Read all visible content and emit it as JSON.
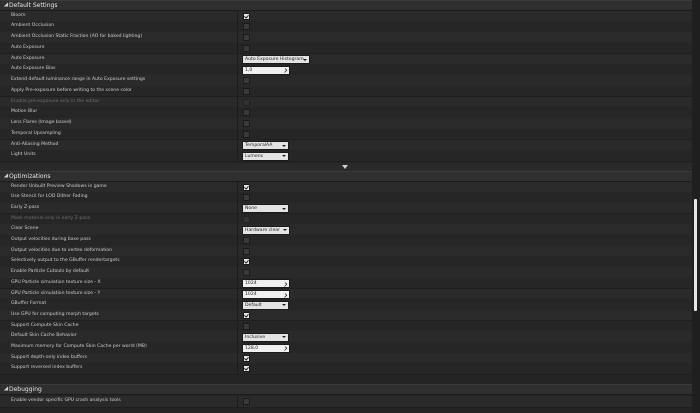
{
  "sections": {
    "default_settings": {
      "title": "Default Settings",
      "rows": [
        {
          "label": "Bloom",
          "control": "checkbox",
          "checked": true
        },
        {
          "label": "Ambient Occlusion",
          "control": "checkbox",
          "checked": false
        },
        {
          "label": "Ambient Occlusion Static Fraction (AO for baked lighting)",
          "control": "checkbox",
          "checked": false
        },
        {
          "label": "Auto Exposure",
          "control": "checkbox",
          "checked": false
        },
        {
          "label": "Auto Exposure",
          "control": "dropdown",
          "value": "Auto Exposure Histogram"
        },
        {
          "label": "Auto Exposure Bias",
          "control": "number",
          "value": "1,0"
        },
        {
          "label": "Extend default luminance range in Auto Exposure settings",
          "control": "checkbox",
          "checked": false
        },
        {
          "label": "Apply Pre-exposure before writing to the scene color",
          "control": "checkbox",
          "checked": false
        },
        {
          "label": "Enable pre-exposure only in the editor",
          "control": "checkbox",
          "checked": false,
          "disabled": true
        },
        {
          "label": "Motion Blur",
          "control": "checkbox",
          "checked": false
        },
        {
          "label": "Lens Flares (Image based)",
          "control": "checkbox",
          "checked": false
        },
        {
          "label": "Temporal Upsampling",
          "control": "checkbox",
          "checked": false
        },
        {
          "label": "Anti-Aliasing Method",
          "control": "dropdown",
          "value": "TemporalAA"
        },
        {
          "label": "Light Units",
          "control": "dropdown",
          "value": "Lumens"
        }
      ]
    },
    "optimizations": {
      "title": "Optimizations",
      "rows": [
        {
          "label": "Render Unbuilt Preview Shadows in game",
          "control": "checkbox",
          "checked": true
        },
        {
          "label": "Use Stencil for LOD Dither Fading",
          "control": "checkbox",
          "checked": false
        },
        {
          "label": "Early Z-pass",
          "control": "dropdown",
          "value": "None"
        },
        {
          "label": "Mask material only in early Z-pass",
          "control": "checkbox",
          "checked": false,
          "disabled": true
        },
        {
          "label": "Clear Scene",
          "control": "dropdown",
          "value": "Hardware clear"
        },
        {
          "label": "Output velocities during base pass",
          "control": "checkbox",
          "checked": false
        },
        {
          "label": "Output velocities due to vertex deformation",
          "control": "checkbox",
          "checked": false
        },
        {
          "label": "Selectively output to the GBuffer rendertargets",
          "control": "checkbox",
          "checked": true
        },
        {
          "label": "Enable Particle Cutouts by default",
          "control": "checkbox",
          "checked": false
        },
        {
          "label": "GPU Particle simulation texture size - X",
          "control": "number",
          "value": "1024"
        },
        {
          "label": "GPU Particle simulation texture size - Y",
          "control": "number",
          "value": "1024"
        },
        {
          "label": "GBuffer Format",
          "control": "dropdown",
          "value": "Default"
        },
        {
          "label": "Use GPU for computing morph targets",
          "control": "checkbox",
          "checked": true
        },
        {
          "label": "Support Compute Skin Cache",
          "control": "checkbox",
          "checked": false
        },
        {
          "label": "Default Skin Cache Behavior",
          "control": "dropdown",
          "value": "Inclusive"
        },
        {
          "label": "Maximum memory for Compute Skin Cache per world (MB)",
          "control": "number",
          "value": "128,0"
        },
        {
          "label": "Support depth-only index buffers",
          "control": "checkbox",
          "checked": true
        },
        {
          "label": "Support reversed index buffers",
          "control": "checkbox",
          "checked": true
        }
      ]
    },
    "debugging": {
      "title": "Debugging",
      "rows": [
        {
          "label": "Enable vendor specific GPU crash analysis tools",
          "control": "checkbox",
          "checked": false
        }
      ]
    }
  },
  "icons": {
    "section_toggle": "collapse-triangle-icon",
    "advanced_expander": "chevron-down-icon",
    "number_drag": "drag-arrow-icon",
    "dropdown": "dropdown-arrow-icon"
  }
}
